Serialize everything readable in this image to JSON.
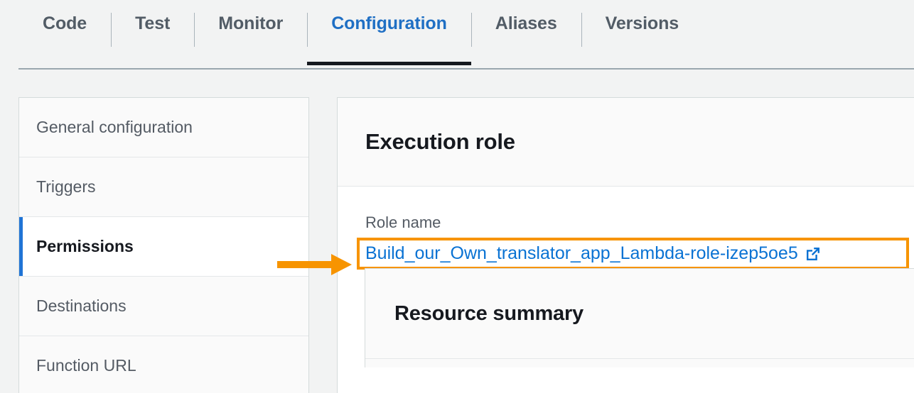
{
  "tabs": [
    {
      "label": "Code",
      "active": false
    },
    {
      "label": "Test",
      "active": false
    },
    {
      "label": "Monitor",
      "active": false
    },
    {
      "label": "Configuration",
      "active": true
    },
    {
      "label": "Aliases",
      "active": false
    },
    {
      "label": "Versions",
      "active": false
    }
  ],
  "sidebar": {
    "items": [
      {
        "label": "General configuration",
        "selected": false
      },
      {
        "label": "Triggers",
        "selected": false
      },
      {
        "label": "Permissions",
        "selected": true
      },
      {
        "label": "Destinations",
        "selected": false
      },
      {
        "label": "Function URL",
        "selected": false
      }
    ]
  },
  "main": {
    "section_title": "Execution role",
    "role_name_label": "Role name",
    "role_name_value": "Build_our_Own_translator_app_Lambda-role-izep5oe5",
    "external_link_icon": "external-link-icon",
    "resource_summary_title": "Resource summary"
  },
  "annotation": {
    "arrow_icon": "right-arrow-annotation",
    "highlight_color": "#f79400"
  },
  "colors": {
    "page_background": "#f2f3f3",
    "active_tab": "#1f6fc4",
    "tab_text": "#525c66",
    "link": "#0972d3",
    "selected_indicator": "#2074d5",
    "annotation_orange": "#f79400",
    "heading": "#16191f"
  }
}
